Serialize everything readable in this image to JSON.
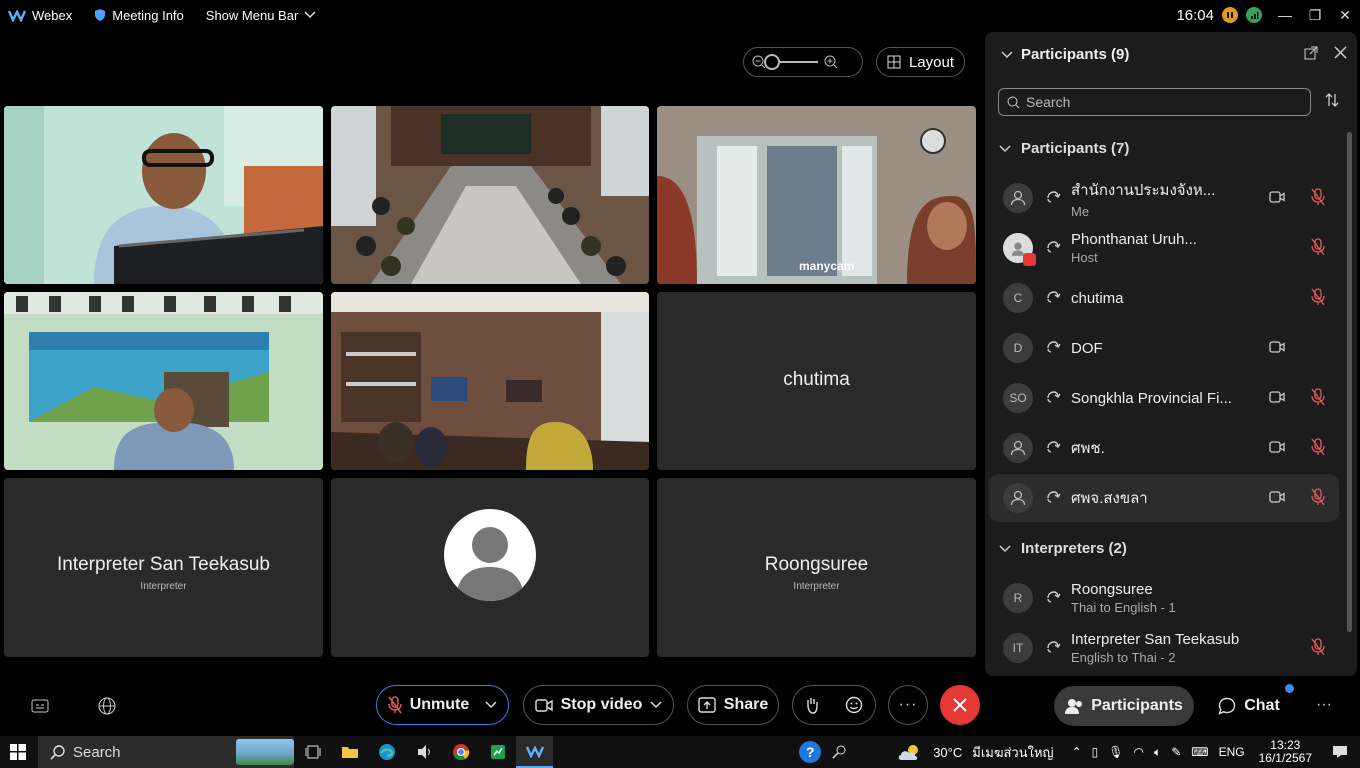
{
  "titlebar": {
    "app_name": "Webex",
    "meeting_info": "Meeting Info",
    "show_menu_bar": "Show Menu Bar",
    "clock": "16:04"
  },
  "view": {
    "layout_label": "Layout"
  },
  "tiles": {
    "chutima_name": "chutima",
    "interpreter_left_name": "Interpreter San Teekasub",
    "interpreter_left_role": "Interpreter",
    "interpreter_right_name": "Roongsuree",
    "interpreter_right_role": "Interpreter",
    "watermark": "manycam"
  },
  "panel": {
    "title": "Participants (9)",
    "search_placeholder": "Search",
    "section_participants": "Participants (7)",
    "section_interpreters": "Interpreters (2)",
    "participants": [
      {
        "name": "สำนักงานประมงจังห...",
        "sub": "Me",
        "initials": "",
        "camera": true,
        "muted": true
      },
      {
        "name": "Phonthanat Uruh...",
        "sub": "Host",
        "initials": "",
        "camera": false,
        "muted": true
      },
      {
        "name": "chutima",
        "sub": "",
        "initials": "C",
        "camera": false,
        "muted": true
      },
      {
        "name": "DOF",
        "sub": "",
        "initials": "D",
        "camera": true,
        "muted": false
      },
      {
        "name": "Songkhla Provincial Fi...",
        "sub": "",
        "initials": "SO",
        "camera": true,
        "muted": true
      },
      {
        "name": "ศพช.",
        "sub": "",
        "initials": "",
        "camera": true,
        "muted": true
      },
      {
        "name": "ศพจ.สงขลา",
        "sub": "",
        "initials": "",
        "camera": true,
        "muted": true
      }
    ],
    "interpreters": [
      {
        "name": "Roongsuree",
        "sub": "Thai to English - 1",
        "initials": "R",
        "muted": false
      },
      {
        "name": "Interpreter San Teekasub",
        "sub": "English to Thai - 2",
        "initials": "IT",
        "muted": true
      }
    ]
  },
  "toolbar": {
    "unmute": "Unmute",
    "stop_video": "Stop video",
    "share": "Share",
    "participants": "Participants",
    "chat": "Chat"
  },
  "taskbar": {
    "search": "Search",
    "weather": "30°C",
    "weather_desc": "มีเมฆส่วนใหญ่",
    "lang": "ENG",
    "time": "13:23",
    "date": "16/1/2567"
  },
  "colors": {
    "accent_blue": "#2f80ed",
    "end_red": "#e53935",
    "muted_red": "#e05a5a"
  }
}
